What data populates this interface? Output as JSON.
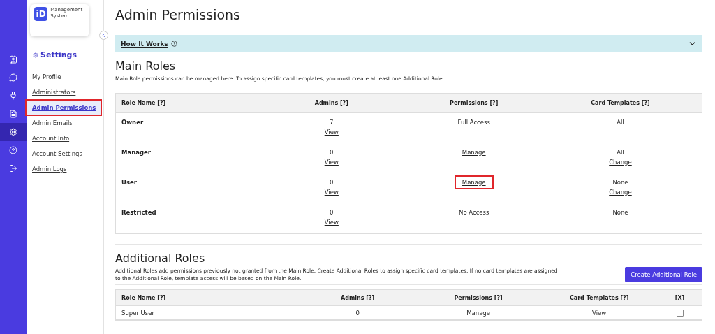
{
  "logo": {
    "mark": "iD",
    "text": "Management System"
  },
  "rail": [
    {
      "selected": false
    },
    {
      "selected": false
    },
    {
      "selected": false
    },
    {
      "selected": false
    },
    {
      "selected": true
    },
    {
      "selected": false
    },
    {
      "selected": false
    }
  ],
  "sidebar": {
    "title": "Settings",
    "items": [
      {
        "label": "My Profile",
        "selected": false
      },
      {
        "label": "Administrators",
        "selected": false
      },
      {
        "label": "Admin Permissions",
        "selected": true
      },
      {
        "label": "Admin Emails",
        "selected": false
      },
      {
        "label": "Account Info",
        "selected": false
      },
      {
        "label": "Account Settings",
        "selected": false
      },
      {
        "label": "Admin Logs",
        "selected": false
      }
    ]
  },
  "page_title": "Admin Permissions",
  "how_it_works": {
    "label": "How It Works",
    "expanded": false
  },
  "main_roles": {
    "title": "Main Roles",
    "description": "Main Role permissions can be managed here. To assign specific card templates, you must create at least one Additional Role.",
    "columns": [
      "Role Name [?]",
      "Admins [?]",
      "Permissions [?]",
      "Card Templates [?]"
    ],
    "rows": [
      {
        "name": "Owner",
        "admins": "7",
        "admins_link": "View",
        "permissions": {
          "kind": "text",
          "text": "Full Access"
        },
        "templates": "All"
      },
      {
        "name": "Manager",
        "admins": "0",
        "admins_link": "View",
        "permissions": {
          "kind": "link",
          "text": "Manage"
        },
        "templates": "All",
        "templates_link": "Change"
      },
      {
        "name": "User",
        "admins": "0",
        "admins_link": "View",
        "permissions": {
          "kind": "link",
          "text": "Manage",
          "highlighted": true
        },
        "templates": "None",
        "templates_link": "Change"
      },
      {
        "name": "Restricted",
        "admins": "0",
        "admins_link": "View",
        "permissions": {
          "kind": "text",
          "text": "No Access"
        },
        "templates": "None"
      }
    ]
  },
  "additional_roles": {
    "title": "Additional Roles",
    "description": "Additional Roles add permissions previously not granted from the Main Role. Create Additional Roles to assign specific card templates. If no card templates are assigned to the Additional Role, template access will be based on the Main Role.",
    "button": "Create Additional Role",
    "columns": [
      "Role Name [?]",
      "Admins [?]",
      "Permissions [?]",
      "Card Templates [?]",
      "[X]"
    ],
    "rows": [
      {
        "name": "Super User",
        "admins": "0",
        "permissions": "Manage",
        "templates": "View",
        "checked": false
      }
    ]
  }
}
